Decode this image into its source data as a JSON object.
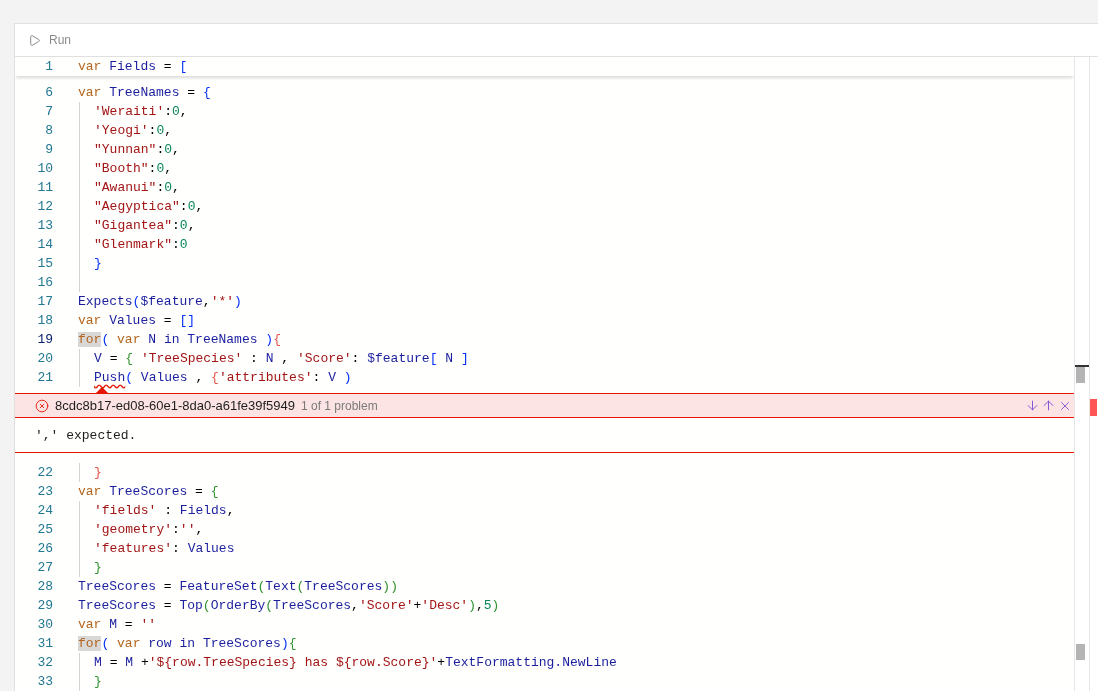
{
  "toolbar": {
    "run_label": "Run"
  },
  "editor": {
    "sticky_line": {
      "number": "1",
      "active": false,
      "indented": false,
      "tokens": [
        {
          "kind": "kw",
          "text": "var"
        },
        {
          "kind": "id",
          "text": "Fields",
          "gap": true
        },
        {
          "kind": "op",
          "text": "=",
          "gap": true
        },
        {
          "kind": "b1",
          "text": "[",
          "gap": true
        }
      ]
    },
    "lines_before": [
      {
        "number": "6",
        "active": false,
        "indented": false,
        "tokens": [
          {
            "kind": "kw",
            "text": "var"
          },
          {
            "kind": "id",
            "text": "TreeNames",
            "gap": true
          },
          {
            "kind": "op",
            "text": "=",
            "gap": true
          },
          {
            "kind": "b1",
            "text": "{",
            "gap": true
          }
        ]
      },
      {
        "number": "7",
        "active": false,
        "indented": true,
        "tokens": [
          {
            "kind": "str",
            "text": "'Weraiti'"
          },
          {
            "kind": "op",
            "text": ":"
          },
          {
            "kind": "num",
            "text": "0"
          },
          {
            "kind": "op",
            "text": ","
          }
        ]
      },
      {
        "number": "8",
        "active": false,
        "indented": true,
        "tokens": [
          {
            "kind": "str",
            "text": "'Yeogi'"
          },
          {
            "kind": "op",
            "text": ":"
          },
          {
            "kind": "num",
            "text": "0"
          },
          {
            "kind": "op",
            "text": ","
          }
        ]
      },
      {
        "number": "9",
        "active": false,
        "indented": true,
        "tokens": [
          {
            "kind": "str",
            "text": "\"Yunnan\""
          },
          {
            "kind": "op",
            "text": ":"
          },
          {
            "kind": "num",
            "text": "0"
          },
          {
            "kind": "op",
            "text": ","
          }
        ]
      },
      {
        "number": "10",
        "active": false,
        "indented": true,
        "tokens": [
          {
            "kind": "str",
            "text": "\"Booth\""
          },
          {
            "kind": "op",
            "text": ":"
          },
          {
            "kind": "num",
            "text": "0"
          },
          {
            "kind": "op",
            "text": ","
          }
        ]
      },
      {
        "number": "11",
        "active": false,
        "indented": true,
        "tokens": [
          {
            "kind": "str",
            "text": "\"Awanui\""
          },
          {
            "kind": "op",
            "text": ":"
          },
          {
            "kind": "num",
            "text": "0"
          },
          {
            "kind": "op",
            "text": ","
          }
        ]
      },
      {
        "number": "12",
        "active": false,
        "indented": true,
        "tokens": [
          {
            "kind": "str",
            "text": "\"Aegyptica\""
          },
          {
            "kind": "op",
            "text": ":"
          },
          {
            "kind": "num",
            "text": "0"
          },
          {
            "kind": "op",
            "text": ","
          }
        ]
      },
      {
        "number": "13",
        "active": false,
        "indented": true,
        "tokens": [
          {
            "kind": "str",
            "text": "\"Gigantea\""
          },
          {
            "kind": "op",
            "text": ":"
          },
          {
            "kind": "num",
            "text": "0"
          },
          {
            "kind": "op",
            "text": ","
          }
        ]
      },
      {
        "number": "14",
        "active": false,
        "indented": true,
        "tokens": [
          {
            "kind": "str",
            "text": "\"Glenmark\""
          },
          {
            "kind": "op",
            "text": ":"
          },
          {
            "kind": "num",
            "text": "0"
          }
        ]
      },
      {
        "number": "15",
        "active": false,
        "indented": true,
        "tokens": [
          {
            "kind": "b1",
            "text": "}"
          }
        ]
      },
      {
        "number": "16",
        "active": false,
        "indented": true
      },
      {
        "number": "17",
        "active": false,
        "indented": false,
        "tokens": [
          {
            "kind": "id",
            "text": "Expects"
          },
          {
            "kind": "b1",
            "text": "("
          },
          {
            "kind": "id",
            "text": "$feature"
          },
          {
            "kind": "op",
            "text": ","
          },
          {
            "kind": "str",
            "text": "'*'"
          },
          {
            "kind": "b1",
            "text": ")"
          }
        ]
      },
      {
        "number": "18",
        "active": false,
        "indented": false,
        "tokens": [
          {
            "kind": "kw",
            "text": "var"
          },
          {
            "kind": "id",
            "text": "Values",
            "gap": true
          },
          {
            "kind": "op",
            "text": "=",
            "gap": true
          },
          {
            "kind": "b1",
            "text": "[]",
            "gap": true
          }
        ]
      },
      {
        "number": "19",
        "active": true,
        "indented": false,
        "tokens": [
          {
            "kind": "kw",
            "text": "for",
            "highlighted": true
          },
          {
            "kind": "b1",
            "text": "("
          },
          {
            "kind": "kw",
            "text": "var",
            "gap": true
          },
          {
            "kind": "id",
            "text": "N",
            "gap": true
          },
          {
            "kind": "id",
            "text": "in",
            "gap": true
          },
          {
            "kind": "id",
            "text": "TreeNames",
            "gap": true
          },
          {
            "kind": "b1",
            "text": ")",
            "gap": true
          },
          {
            "kind": "b3",
            "text": "{"
          }
        ]
      },
      {
        "number": "20",
        "active": false,
        "indented": true,
        "tokens": [
          {
            "kind": "id",
            "text": "V"
          },
          {
            "kind": "op",
            "text": "=",
            "gap": true
          },
          {
            "kind": "b2",
            "text": "{",
            "gap": true
          },
          {
            "kind": "str",
            "text": "'TreeSpecies'",
            "gap": true
          },
          {
            "kind": "op",
            "text": ":",
            "gap": true
          },
          {
            "kind": "id",
            "text": "N",
            "gap": true
          },
          {
            "kind": "op",
            "text": ",",
            "gap": true
          },
          {
            "kind": "str",
            "text": "'Score'",
            "gap": true
          },
          {
            "kind": "op",
            "text": ":"
          },
          {
            "kind": "id",
            "text": "$feature",
            "gap": true
          },
          {
            "kind": "b1",
            "text": "["
          },
          {
            "kind": "id",
            "text": "N",
            "gap": true
          },
          {
            "kind": "b1",
            "text": "]",
            "gap": true
          }
        ]
      },
      {
        "number": "21",
        "active": false,
        "indented": true,
        "tokens": [
          {
            "kind": "id",
            "text": "Push",
            "error": true
          },
          {
            "kind": "b1",
            "text": "("
          },
          {
            "kind": "id",
            "text": "Values",
            "gap": true
          },
          {
            "kind": "op",
            "text": ",",
            "gap": true
          },
          {
            "kind": "b3",
            "text": "{",
            "gap": true
          },
          {
            "kind": "str",
            "text": "'attributes'"
          },
          {
            "kind": "op",
            "text": ":"
          },
          {
            "kind": "id",
            "text": "V",
            "gap": true
          },
          {
            "kind": "b1",
            "text": ")",
            "gap": true
          }
        ]
      }
    ],
    "problem": {
      "id": "8cdc8b17-ed08-60e1-8da0-a61fe39f5949",
      "count": "1 of 1 problem",
      "message": "',' expected."
    },
    "lines_after": [
      {
        "number": "22",
        "active": false,
        "indented": true,
        "tokens": [
          {
            "kind": "b3",
            "text": "}"
          }
        ]
      },
      {
        "number": "23",
        "active": false,
        "indented": false,
        "tokens": [
          {
            "kind": "kw",
            "text": "var"
          },
          {
            "kind": "id",
            "text": "TreeScores",
            "gap": true
          },
          {
            "kind": "op",
            "text": "=",
            "gap": true
          },
          {
            "kind": "b2",
            "text": "{",
            "gap": true
          }
        ]
      },
      {
        "number": "24",
        "active": false,
        "indented": true,
        "tokens": [
          {
            "kind": "str",
            "text": "'fields'"
          },
          {
            "kind": "op",
            "text": ":",
            "gap": true
          },
          {
            "kind": "id",
            "text": "Fields",
            "gap": true
          },
          {
            "kind": "op",
            "text": ","
          }
        ]
      },
      {
        "number": "25",
        "active": false,
        "indented": true,
        "tokens": [
          {
            "kind": "str",
            "text": "'geometry'"
          },
          {
            "kind": "op",
            "text": ":"
          },
          {
            "kind": "str",
            "text": "''"
          },
          {
            "kind": "op",
            "text": ","
          }
        ]
      },
      {
        "number": "26",
        "active": false,
        "indented": true,
        "tokens": [
          {
            "kind": "str",
            "text": "'features'"
          },
          {
            "kind": "op",
            "text": ":"
          },
          {
            "kind": "id",
            "text": "Values",
            "gap": true
          }
        ]
      },
      {
        "number": "27",
        "active": false,
        "indented": true,
        "tokens": [
          {
            "kind": "b2",
            "text": "}"
          }
        ]
      },
      {
        "number": "28",
        "active": false,
        "indented": false,
        "tokens": [
          {
            "kind": "id",
            "text": "TreeScores"
          },
          {
            "kind": "op",
            "text": "=",
            "gap": true
          },
          {
            "kind": "id",
            "text": "FeatureSet",
            "gap": true
          },
          {
            "kind": "b2",
            "text": "("
          },
          {
            "kind": "id",
            "text": "Text"
          },
          {
            "kind": "b2",
            "text": "("
          },
          {
            "kind": "id",
            "text": "TreeScores"
          },
          {
            "kind": "b2",
            "text": "))"
          }
        ]
      },
      {
        "number": "29",
        "active": false,
        "indented": false,
        "tokens": [
          {
            "kind": "id",
            "text": "TreeScores"
          },
          {
            "kind": "op",
            "text": "=",
            "gap": true
          },
          {
            "kind": "id",
            "text": "Top",
            "gap": true
          },
          {
            "kind": "b2",
            "text": "("
          },
          {
            "kind": "id",
            "text": "OrderBy"
          },
          {
            "kind": "b2",
            "text": "("
          },
          {
            "kind": "id",
            "text": "TreeScores"
          },
          {
            "kind": "op",
            "text": ","
          },
          {
            "kind": "str",
            "text": "'Score'"
          },
          {
            "kind": "op",
            "text": "+"
          },
          {
            "kind": "str",
            "text": "'Desc'"
          },
          {
            "kind": "b2",
            "text": ")"
          },
          {
            "kind": "op",
            "text": ","
          },
          {
            "kind": "num",
            "text": "5"
          },
          {
            "kind": "b2",
            "text": ")"
          }
        ]
      },
      {
        "number": "30",
        "active": false,
        "indented": false,
        "tokens": [
          {
            "kind": "kw",
            "text": "var"
          },
          {
            "kind": "id",
            "text": "M",
            "gap": true
          },
          {
            "kind": "op",
            "text": "=",
            "gap": true
          },
          {
            "kind": "str",
            "text": "''",
            "gap": true
          }
        ]
      },
      {
        "number": "31",
        "active": false,
        "indented": false,
        "tokens": [
          {
            "kind": "kw",
            "text": "for",
            "highlighted": true
          },
          {
            "kind": "b1",
            "text": "("
          },
          {
            "kind": "kw",
            "text": "var",
            "gap": true
          },
          {
            "kind": "id",
            "text": "row",
            "gap": true
          },
          {
            "kind": "id",
            "text": "in",
            "gap": true
          },
          {
            "kind": "id",
            "text": "TreeScores",
            "gap": true
          },
          {
            "kind": "b1",
            "text": ")"
          },
          {
            "kind": "b2",
            "text": "{"
          }
        ]
      },
      {
        "number": "32",
        "active": false,
        "indented": true,
        "tokens": [
          {
            "kind": "id",
            "text": "M"
          },
          {
            "kind": "op",
            "text": "=",
            "gap": true
          },
          {
            "kind": "id",
            "text": "M",
            "gap": true
          },
          {
            "kind": "op",
            "text": "+",
            "gap": true
          },
          {
            "kind": "str",
            "text": "'${row.TreeSpecies} has ${row.Score}'"
          },
          {
            "kind": "op",
            "text": "+"
          },
          {
            "kind": "id",
            "text": "TextFormatting.NewLine"
          }
        ]
      },
      {
        "number": "33",
        "active": false,
        "indented": true,
        "tokens": [
          {
            "kind": "b2",
            "text": "}"
          }
        ]
      }
    ]
  }
}
